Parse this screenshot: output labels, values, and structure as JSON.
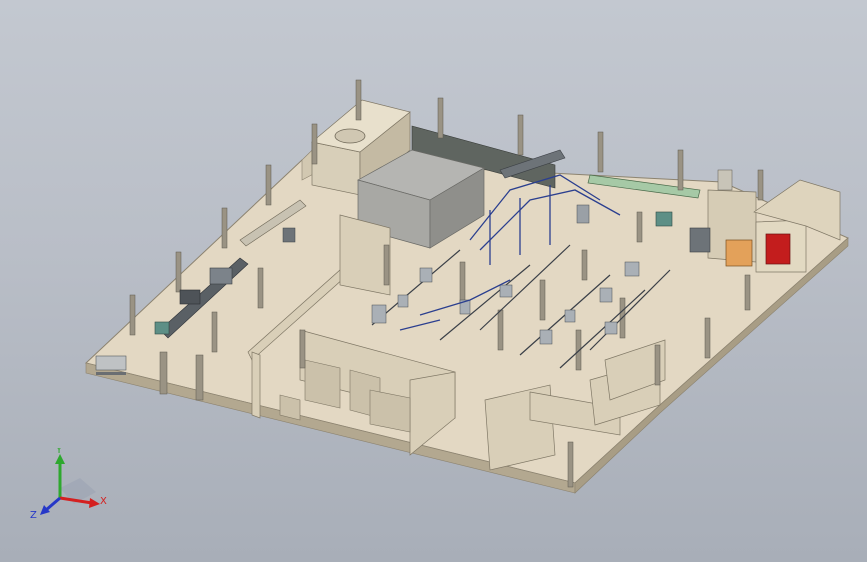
{
  "viewport": {
    "background_top": "#c3c8d0",
    "background_bottom": "#a8aeb8"
  },
  "scene": {
    "floor_color": "#e3d8c3",
    "floor_edge_color": "#b3a890",
    "wall_color": "#ddd3bd",
    "wall_dark_color": "#b9ae97",
    "column_color": "#9a9384",
    "machine_dark_color": "#4e5358",
    "conveyor_color": "#8f969d",
    "accent_blue": "#2b3f8f",
    "accent_red": "#c31d1d",
    "accent_green": "#7fb07f"
  },
  "triad": {
    "x_label": "X",
    "y_label": "Y",
    "z_label": "Z",
    "x_color": "#d42020",
    "y_color": "#2ea82e",
    "z_color": "#2638c8"
  }
}
